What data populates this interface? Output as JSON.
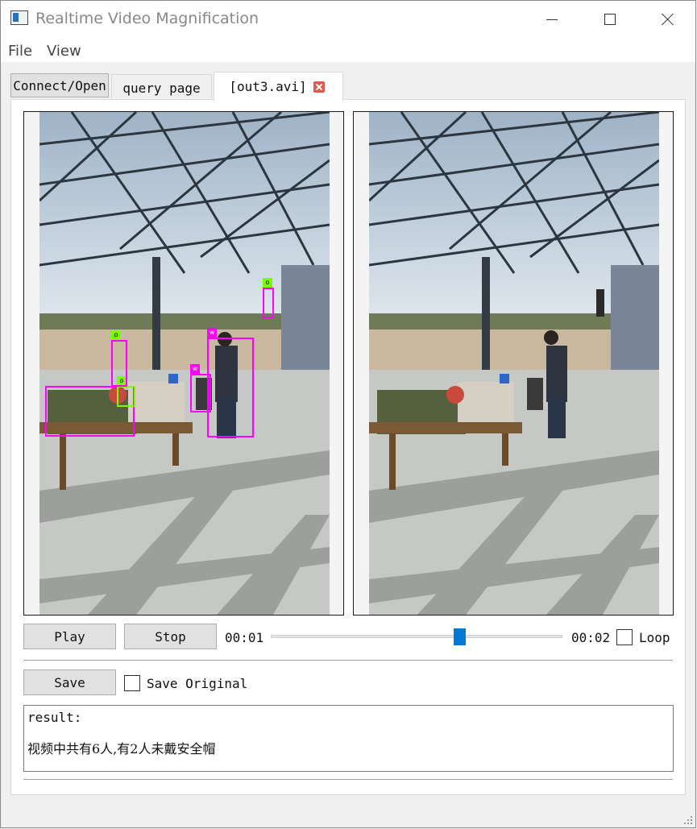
{
  "window": {
    "title": "Realtime Video Magnification"
  },
  "menu": {
    "items": [
      "File",
      "View"
    ]
  },
  "tabs": [
    "Connect/Open",
    "query page",
    "[out3.avi]"
  ],
  "video": {
    "left_boxes": [
      "o",
      "o",
      "o",
      "w",
      "w"
    ]
  },
  "controls": {
    "play_label": "Play",
    "stop_label": "Stop",
    "time_current": "00:01",
    "time_total": "00:02",
    "progress_fraction": 0.63,
    "loop_label": "Loop",
    "loop_checked": false
  },
  "save": {
    "save_label": "Save",
    "save_original_label": "Save Original",
    "save_original_checked": false
  },
  "result": {
    "line1": "result:",
    "line2": "视频中共有6人,有2人未戴安全帽"
  }
}
